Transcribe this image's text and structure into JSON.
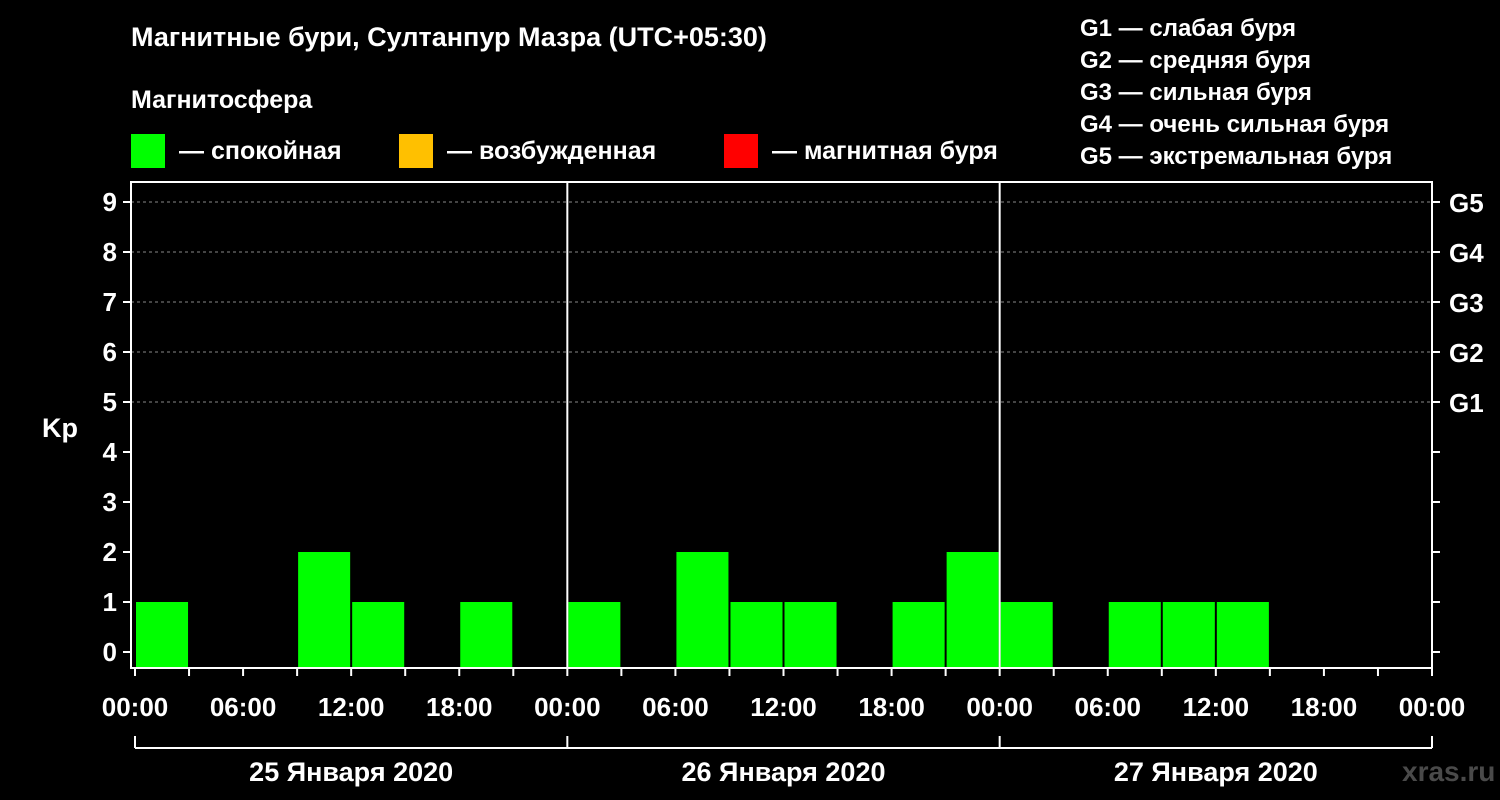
{
  "header": {
    "title": "Магнитные бури, Султанпур Мазра (UTC+05:30)",
    "subtitle": "Магнитосфера"
  },
  "legend": [
    {
      "label": "— спокойная",
      "color": "#00ff00"
    },
    {
      "label": "— возбужденная",
      "color": "#ffc000"
    },
    {
      "label": "— магнитная буря",
      "color": "#ff0000"
    }
  ],
  "storm_levels": [
    "G1 — слабая буря",
    "G2 — средняя буря",
    "G3 — сильная буря",
    "G4 — очень сильная буря",
    "G5 — экстремальная буря"
  ],
  "watermark": "xras.ru",
  "chart_data": {
    "type": "bar",
    "ylabel": "Kp",
    "ylim": [
      0,
      9
    ],
    "yticks": [
      "0",
      "1",
      "2",
      "3",
      "4",
      "5",
      "6",
      "7",
      "8",
      "9"
    ],
    "right_axis": [
      {
        "value": 5,
        "label": "G1"
      },
      {
        "value": 6,
        "label": "G2"
      },
      {
        "value": 7,
        "label": "G3"
      },
      {
        "value": 8,
        "label": "G4"
      },
      {
        "value": 9,
        "label": "G5"
      }
    ],
    "x_tick_labels": [
      "00:00",
      "06:00",
      "12:00",
      "18:00",
      "00:00",
      "06:00",
      "12:00",
      "18:00",
      "00:00",
      "06:00",
      "12:00",
      "18:00",
      "00:00"
    ],
    "days": [
      "25 Января 2020",
      "26 Января 2020",
      "27 Января 2020"
    ],
    "grid_dashed": true,
    "bars": [
      {
        "start_hour": 0,
        "end_hour": 3,
        "kp": 1,
        "color": "#00ff00"
      },
      {
        "start_hour": 3,
        "end_hour": 6,
        "kp": 0,
        "color": "#00ff00"
      },
      {
        "start_hour": 6,
        "end_hour": 9,
        "kp": 0,
        "color": "#00ff00"
      },
      {
        "start_hour": 9,
        "end_hour": 12,
        "kp": 2,
        "color": "#00ff00"
      },
      {
        "start_hour": 12,
        "end_hour": 15,
        "kp": 1,
        "color": "#00ff00"
      },
      {
        "start_hour": 15,
        "end_hour": 18,
        "kp": 0,
        "color": "#00ff00"
      },
      {
        "start_hour": 18,
        "end_hour": 21,
        "kp": 1,
        "color": "#00ff00"
      },
      {
        "start_hour": 21,
        "end_hour": 24,
        "kp": 0,
        "color": "#00ff00"
      },
      {
        "start_hour": 24,
        "end_hour": 27,
        "kp": 1,
        "color": "#00ff00"
      },
      {
        "start_hour": 27,
        "end_hour": 30,
        "kp": 0,
        "color": "#00ff00"
      },
      {
        "start_hour": 30,
        "end_hour": 33,
        "kp": 2,
        "color": "#00ff00"
      },
      {
        "start_hour": 33,
        "end_hour": 36,
        "kp": 1,
        "color": "#00ff00"
      },
      {
        "start_hour": 36,
        "end_hour": 39,
        "kp": 1,
        "color": "#00ff00"
      },
      {
        "start_hour": 39,
        "end_hour": 42,
        "kp": 0,
        "color": "#00ff00"
      },
      {
        "start_hour": 42,
        "end_hour": 45,
        "kp": 1,
        "color": "#00ff00"
      },
      {
        "start_hour": 45,
        "end_hour": 48,
        "kp": 2,
        "color": "#00ff00"
      },
      {
        "start_hour": 48,
        "end_hour": 51,
        "kp": 1,
        "color": "#00ff00"
      },
      {
        "start_hour": 51,
        "end_hour": 54,
        "kp": 0,
        "color": "#00ff00"
      },
      {
        "start_hour": 54,
        "end_hour": 57,
        "kp": 1,
        "color": "#00ff00"
      },
      {
        "start_hour": 57,
        "end_hour": 60,
        "kp": 1,
        "color": "#00ff00"
      },
      {
        "start_hour": 60,
        "end_hour": 63,
        "kp": 1,
        "color": "#00ff00"
      }
    ]
  }
}
